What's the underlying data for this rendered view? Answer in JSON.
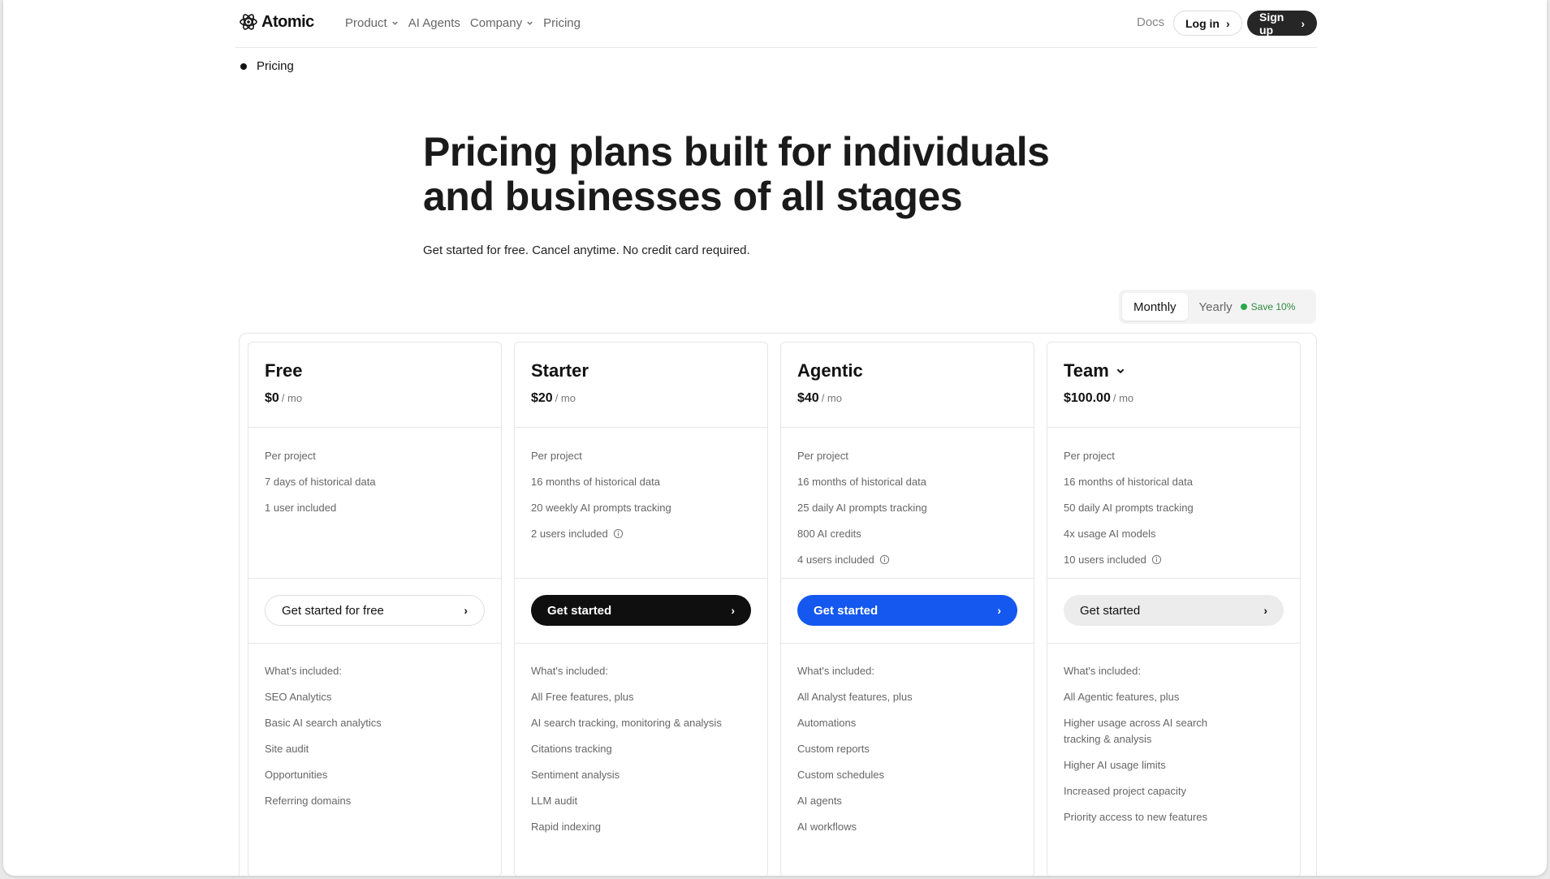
{
  "nav": {
    "logo_text": "Atomic",
    "links": [
      "Product",
      "AI Agents",
      "Company",
      "Pricing"
    ],
    "docs": "Docs",
    "login": "Log in",
    "signup": "Sign up"
  },
  "breadcrumb": "Pricing",
  "hero": {
    "title": "Pricing plans built for individuals and businesses of all stages",
    "subtitle": "Get started for free. Cancel anytime. No credit card required."
  },
  "billing_toggle": {
    "monthly": "Monthly",
    "yearly": "Yearly",
    "save": "Save 10%",
    "selected": "Monthly"
  },
  "plans": [
    {
      "name": "Free",
      "price": "$0",
      "per": "/ mo",
      "limits": [
        "Per project",
        "7 days of historical data",
        "1 user included"
      ],
      "cta": "Get started for free",
      "features_label": "What's included:",
      "features": [
        "SEO Analytics",
        "Basic AI search analytics",
        "Site audit",
        "Opportunities",
        "Referring domains"
      ]
    },
    {
      "name": "Starter",
      "price": "$20",
      "per": "/ mo",
      "limits": [
        "Per project",
        "16 months of historical data",
        "20 weekly AI prompts tracking",
        "2 users included"
      ],
      "cta": "Get started",
      "features_label": "What's included:",
      "features": [
        "All Free features, plus",
        "AI search tracking, monitoring & analysis",
        "Citations tracking",
        "Sentiment analysis",
        "LLM audit",
        "Rapid indexing"
      ]
    },
    {
      "name": "Agentic",
      "price": "$40",
      "per": "/ mo",
      "limits": [
        "Per project",
        "16 months of historical data",
        "25 daily AI prompts tracking",
        "800 AI credits",
        "4 users included"
      ],
      "cta": "Get started",
      "features_label": "What's included:",
      "features": [
        "All Analyst features, plus",
        "Automations",
        "Custom reports",
        "Custom schedules",
        "AI agents",
        "AI workflows"
      ]
    },
    {
      "name": "Team",
      "price": "$100.00",
      "per": "/ mo",
      "limits": [
        "Per project",
        "16 months of historical data",
        "50 daily AI prompts tracking",
        "4x usage AI models",
        "10 users included"
      ],
      "cta": "Get started",
      "features_label": "What's included:",
      "features": [
        "All Agentic features, plus",
        "Higher usage across AI search tracking & analysis",
        "Higher AI usage limits",
        "Increased project capacity",
        "Priority access to new features"
      ]
    }
  ],
  "colors": {
    "accent_blue": "#1458ef",
    "dark": "#0f0f0f",
    "save_green": "#2aa84a"
  }
}
